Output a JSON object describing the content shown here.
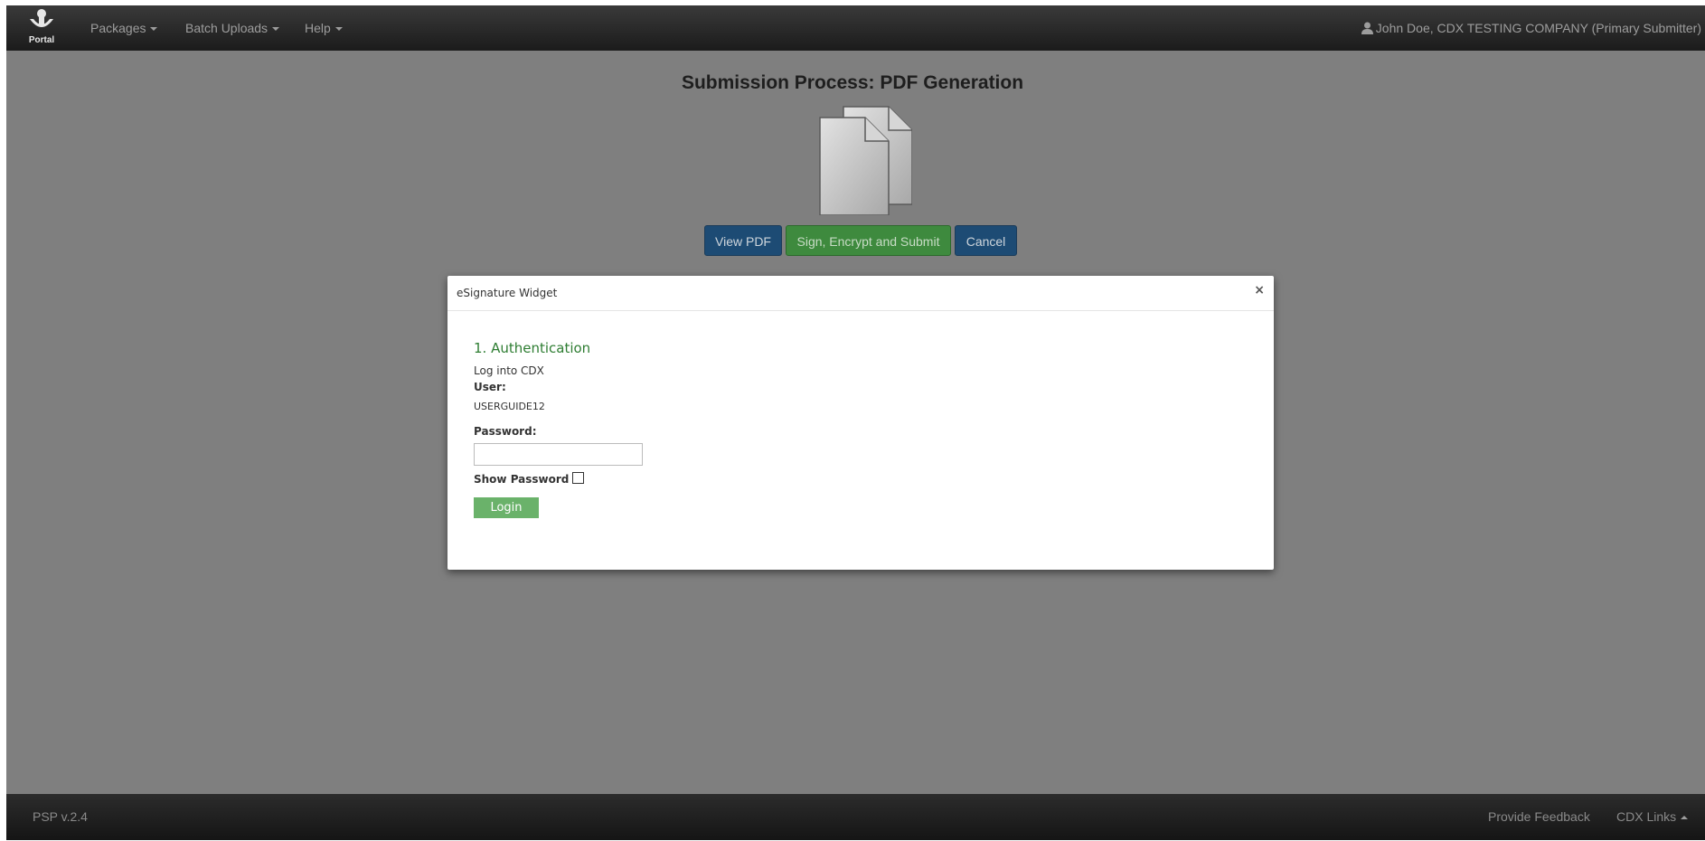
{
  "navbar": {
    "brand_label": "Portal",
    "menu": [
      {
        "label": "Packages"
      },
      {
        "label": "Batch Uploads"
      },
      {
        "label": "Help"
      }
    ],
    "user_text": "John Doe, CDX TESTING COMPANY (Primary Submitter)"
  },
  "main": {
    "title": "Submission Process: PDF Generation",
    "buttons": {
      "view_pdf": "View PDF",
      "sign_submit": "Sign, Encrypt and Submit",
      "cancel": "Cancel"
    }
  },
  "modal": {
    "title": "eSignature Widget",
    "close": "×",
    "section_title": "1. Authentication",
    "log_into": "Log into CDX",
    "user_label": "User:",
    "user_value": "USERGUIDE12",
    "password_label": "Password:",
    "password_value": "",
    "show_password_label": "Show Password",
    "show_password_checked": false,
    "login_button": "Login"
  },
  "footer": {
    "version": "PSP  v.2.4",
    "feedback": "Provide Feedback",
    "cdx_links": "CDX Links"
  },
  "colors": {
    "navbar": "#222222",
    "overlay_bg": "#7f7f7f",
    "primary_button": "#1d4b74",
    "success_button": "#3e8a3e",
    "section_title": "#2e7d32",
    "login_button": "#6ab26a"
  },
  "icons": {
    "brand": "portal-logo-icon",
    "user": "user-icon",
    "document": "documents-icon"
  }
}
